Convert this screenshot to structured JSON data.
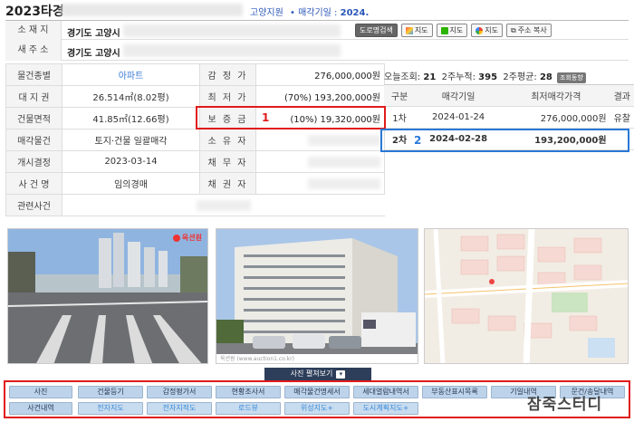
{
  "header": {
    "case_no": "2023타경",
    "court": "고양지원",
    "sale_label": "• 매각기일 : ",
    "sale_value": "2024."
  },
  "address": {
    "location_label": "소 재 지",
    "location_value": "경기도 고양시",
    "new_address_label": "새 주 소",
    "new_address_value": "경기도 고양시",
    "buttons": {
      "road_view": "도로명검색",
      "map1": "지도",
      "map2": "지도",
      "map3": "지도",
      "copy": "주소 복사"
    }
  },
  "info": {
    "rows": [
      {
        "l1": "물건종별",
        "v1": "아파트",
        "l2": "감 정 가",
        "v2": "276,000,000원"
      },
      {
        "l1": "대 지 권",
        "v1": "26.514㎡(8.02평)",
        "l2": "최 저 가",
        "v2": "(70%) 193,200,000원"
      },
      {
        "l1": "건물면적",
        "v1": "41.85㎡(12.66평)",
        "l2": "보 증 금",
        "v2": "(10%) 19,320,000원"
      },
      {
        "l1": "매각물건",
        "v1": "토지·건물 일괄매각",
        "l2": "소 유 자",
        "v2": ""
      },
      {
        "l1": "개시결정",
        "v1": "2023-03-14",
        "l2": "채 무 자",
        "v2": ""
      },
      {
        "l1": "사 건 명",
        "v1": "임의경매",
        "l2": "채 권 자",
        "v2": ""
      },
      {
        "l1": "관련사건",
        "v1": "",
        "l2": "",
        "v2": ""
      }
    ]
  },
  "stats": {
    "today_label": "오늘조회:",
    "today_value": "21",
    "week_label": "2주누적:",
    "week_value": "395",
    "avg_label": "2주평균:",
    "avg_value": "28",
    "tag": "조회동향"
  },
  "history": {
    "headers": [
      "구분",
      "매각기일",
      "최저매각가격",
      "결과"
    ],
    "rows": [
      {
        "round": "1차",
        "date": "2024-01-24",
        "price": "276,000,000원",
        "result": "유찰"
      },
      {
        "round": "2차",
        "date": "2024-02-28",
        "price": "193,200,000원",
        "result": ""
      }
    ]
  },
  "annotations": {
    "one": "1",
    "two": "2"
  },
  "photos": {
    "logo": "옥션원",
    "view_all": "사진 펼쳐보기",
    "caption": "옥션원 (www.auction1.co.kr)"
  },
  "bottom_buttons": {
    "row1": [
      "사진",
      "건물등기",
      "감정평가서",
      "현황조사서",
      "매각물건명세서",
      "세대열람내역서",
      "부동산표시목록",
      "기일내역",
      "문건/송달내역"
    ],
    "row2": [
      "사건내역",
      "전자지도",
      "전자지적도",
      "로드뷰",
      "위성지도+",
      "도시계획지도+"
    ]
  },
  "watermark": "잠죽스터디",
  "colors": {
    "accent_blue": "#2a56b8",
    "annotation_red": "#e01b1b",
    "annotation_blue": "#2a78d6",
    "button_bg": "#bcd3ea"
  }
}
